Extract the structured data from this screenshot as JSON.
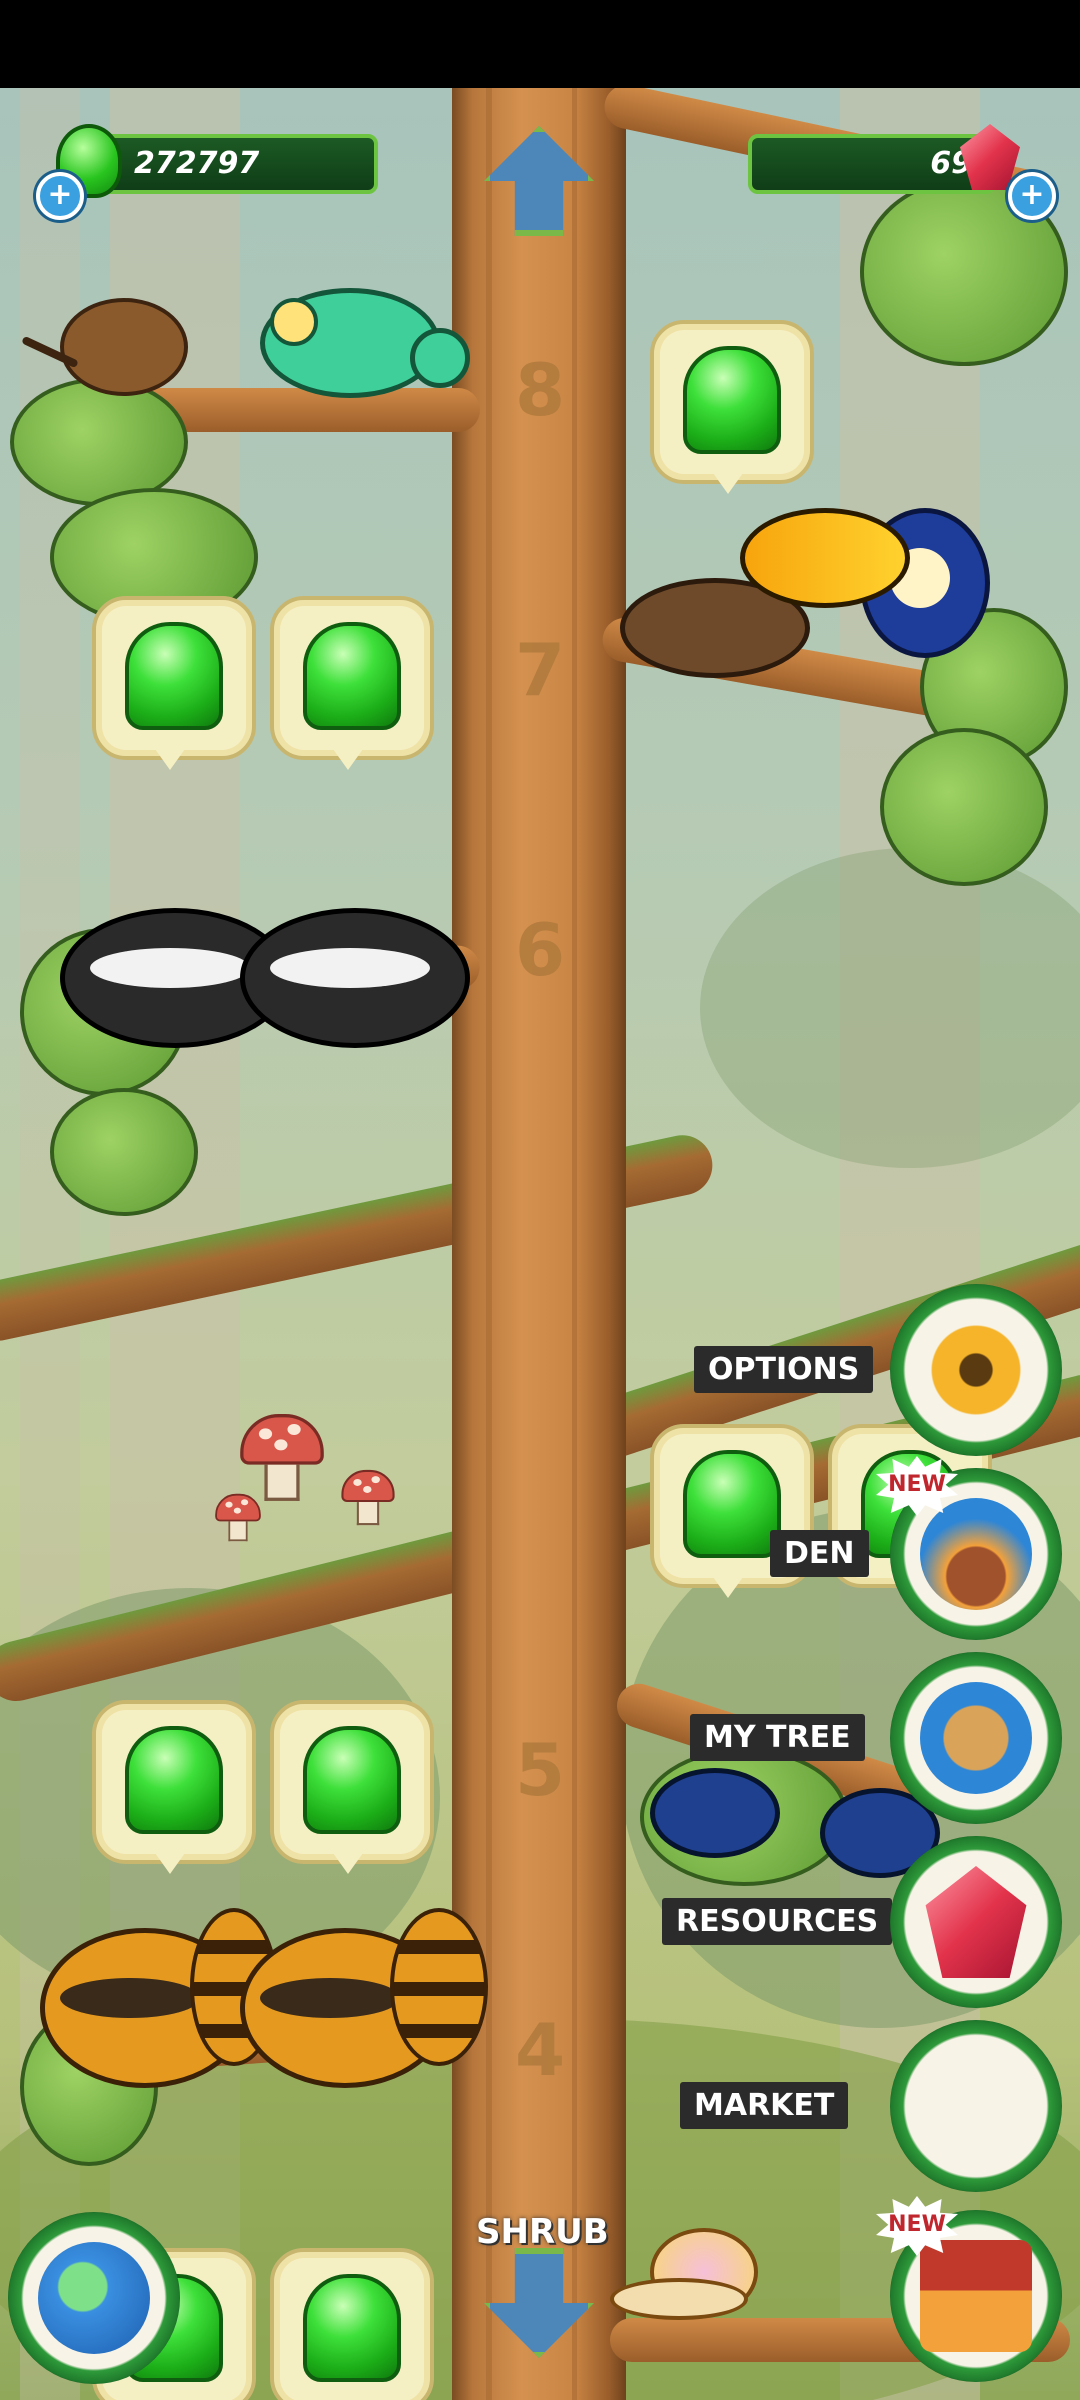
{
  "hud": {
    "goo_amount": "272797",
    "gem_amount": "69",
    "add_goo_label": "+",
    "add_gems_label": "+"
  },
  "floors": [
    "8",
    "7",
    "6",
    "5",
    "4"
  ],
  "tree_label": "SHRUB",
  "menu": {
    "options_label": "OPTIONS",
    "den_label": "DEN",
    "my_tree_label": "MY TREE",
    "resources_label": "RESOURCES",
    "market_label": "MARKET",
    "new_badge": "NEW"
  },
  "colors": {
    "goo_green": "#29c51f",
    "currency_bar": "#0f3d17",
    "menu_ring": "#2e9a3a",
    "gem_red": "#e2334b",
    "plus_blue": "#3aa0e0"
  },
  "icons": {
    "up": "arrow-up-icon",
    "down": "arrow-down-icon",
    "options": "gear-icon",
    "den": "cat-den-icon",
    "my_tree": "clipboard-checklist-icon",
    "resources": "red-crystal-icon",
    "market": "market-stall-icon",
    "world": "globe-icon",
    "home": "treehouse-icon"
  }
}
